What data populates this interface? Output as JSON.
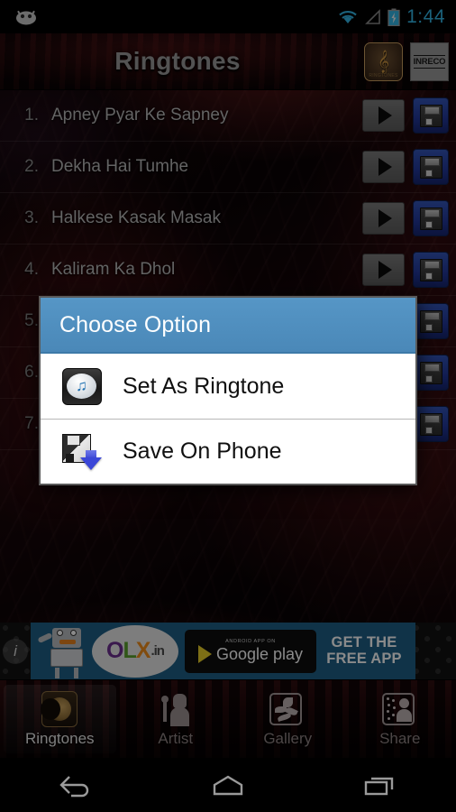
{
  "status_bar": {
    "notification_icon": "android-robot-icon",
    "wifi_icon": "wifi-icon",
    "signal_icon": "cell-signal-icon",
    "battery_icon": "battery-charging-icon",
    "time": "1:44"
  },
  "action_bar": {
    "title": "Ringtones",
    "logo_ringtone": {
      "icon": "music-note-icon",
      "caption": "RINGTONES"
    },
    "logo_label": "INRECO"
  },
  "list": {
    "rows": [
      {
        "num": "1.",
        "title": "Apney Pyar Ke Sapney"
      },
      {
        "num": "2.",
        "title": "Dekha Hai Tumhe"
      },
      {
        "num": "3.",
        "title": "Halkese Kasak Masak"
      },
      {
        "num": "4.",
        "title": "Kaliram Ka Dhol"
      },
      {
        "num": "5.",
        "title": ""
      },
      {
        "num": "6.",
        "title": ""
      },
      {
        "num": "7.",
        "title": ""
      }
    ],
    "play_icon": "play-icon",
    "save_icon": "floppy-save-icon"
  },
  "dialog": {
    "title": "Choose Option",
    "header_color": "#4a88b8",
    "options": [
      {
        "label": "Set As Ringtone",
        "icon": "music-note-ringtone-icon"
      },
      {
        "label": "Save On Phone",
        "icon": "save-to-phone-icon"
      }
    ]
  },
  "ad": {
    "info_icon": "info-icon",
    "brand_o": "O",
    "brand_l": "L",
    "brand_x": "X",
    "brand_suffix": ".in",
    "store_small": "ANDROID APP ON",
    "store_name_bold": "Google",
    "store_name_light": " play",
    "cta_line1": "GET THE",
    "cta_line2": "FREE APP"
  },
  "tabs": [
    {
      "label": "Ringtones",
      "icon": "ringtones-disc-icon",
      "selected": true
    },
    {
      "label": "Artist",
      "icon": "artist-mic-icon",
      "selected": false
    },
    {
      "label": "Gallery",
      "icon": "gallery-flower-icon",
      "selected": false
    },
    {
      "label": "Share",
      "icon": "share-person-icon",
      "selected": false
    }
  ],
  "nav_bar": {
    "back": "back-icon",
    "home": "home-icon",
    "recents": "recents-icon"
  }
}
